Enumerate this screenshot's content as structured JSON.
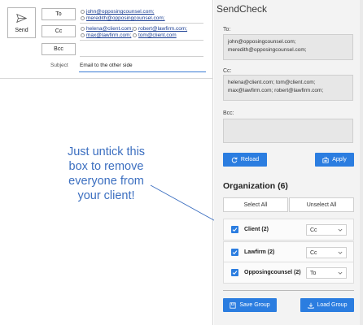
{
  "compose": {
    "send_label": "Send",
    "to_label": "To",
    "cc_label": "Cc",
    "bcc_label": "Bcc",
    "subject_label": "Subject",
    "subject_value": "Email to the other side",
    "to_recipients": [
      "john@opposingcounsel.com;",
      "meredith@opposingcounsel.com;"
    ],
    "cc_recipients": [
      "helena@client.com;",
      "robert@lawfirm.com;",
      "max@lawfirm.com;",
      "tom@client.com"
    ]
  },
  "annotation": {
    "text": "Just untick this box to remove everyone from your client!"
  },
  "panel": {
    "title": "SendCheck",
    "to_label": "To:",
    "to_lines": [
      "john@opposingcounsel.com;",
      "meredith@opposingcounsel.com;"
    ],
    "cc_label": "Cc:",
    "cc_lines": [
      "helena@client.com; tom@client.com;",
      "max@lawfirm.com; robert@lawfirm.com;"
    ],
    "bcc_label": "Bcc:",
    "reload_label": "Reload",
    "apply_label": "Apply",
    "org_title": "Organization (6)",
    "select_all_label": "Select All",
    "unselect_all_label": "Unselect All",
    "organizations": [
      {
        "name": "Client (2)",
        "field": "Cc",
        "checked": true
      },
      {
        "name": "Lawfirm (2)",
        "field": "Cc",
        "checked": true
      },
      {
        "name": "Opposingcounsel (2)",
        "field": "To",
        "checked": true
      }
    ],
    "save_group_label": "Save Group",
    "load_group_label": "Load Group"
  },
  "colors": {
    "accent": "#2b7de0",
    "annotation": "#3c6fc0",
    "link": "#1c3f94"
  }
}
